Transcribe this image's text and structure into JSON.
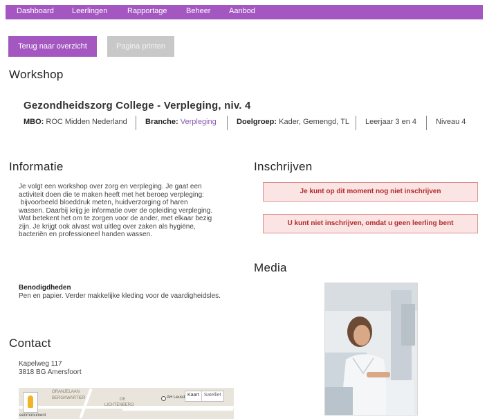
{
  "nav": {
    "items": [
      "Dashboard",
      "Leerlingen",
      "Rapportage",
      "Beheer",
      "Aanbod"
    ]
  },
  "actions": {
    "back": "Terug naar overzicht",
    "print": "Pagina printen"
  },
  "workshop": {
    "heading": "Workshop",
    "title": "Gezondheidszorg College - Verpleging, niv. 4",
    "mbo_label": "MBO:",
    "mbo_value": "ROC Midden Nederland",
    "branche_label": "Branche:",
    "branche_value": "Verpleging",
    "doelgroep_label": "Doelgroep:",
    "doelgroep_value": "Kader, Gemengd, TL",
    "leerjaar": "Leerjaar 3 en 4",
    "niveau": "Niveau 4"
  },
  "informatie": {
    "heading": "Informatie",
    "lines": [
      "Je volgt een workshop over zorg en verpleging. Je gaat een",
      "activiteit doen die te maken heeft met het beroep verpleging:",
      " bijvoorbeeld bloeddruk meten, huidverzorging of haren",
      "wassen. Daarbij krijg je informatie over de opleiding verpleging.",
      "Wat betekent het om te zorgen voor de ander, met elkaar bezig",
      "zijn. Je krijgt ook alvast wat uitleg over zaken als hygiëne,",
      "bacteriën en professioneel handen wassen."
    ],
    "needs_title": "Benodigdheden",
    "needs_text": "Pen en papier. Verder makkelijke kleding voor de vaardigheidsles."
  },
  "contact": {
    "heading": "Contact",
    "street": "Kapelweg 117",
    "city": "3818 BG Amersfoort"
  },
  "map": {
    "labels": [
      "ORANJELAAN",
      "BERGKWARTIER",
      "DE",
      "LICHTENBERG",
      "AH Leusderweg",
      "eenmonument"
    ],
    "toggle_map": "Kaart",
    "toggle_sat": "Satelliet"
  },
  "inschrijven": {
    "heading": "Inschrijven",
    "alert1": "Je kunt op dit moment nog niet inschrijven",
    "alert2": "U kunt niet inschrijven, omdat u geen leerling bent"
  },
  "media": {
    "heading": "Media"
  },
  "colors": {
    "accent": "#a457c1",
    "alert_bg": "#fbe4e4",
    "alert_border": "#e08c8c",
    "alert_text": "#b22a2a",
    "link": "#8a5bb5"
  }
}
